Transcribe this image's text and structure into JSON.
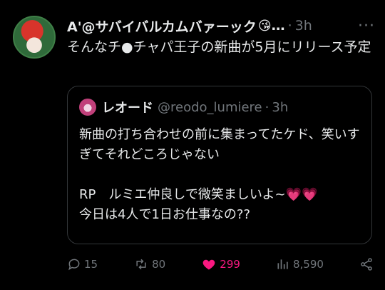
{
  "tweet": {
    "display_name": "A'@サバイバルカムバァーック",
    "emoji": "😘",
    "ellipsis": "…",
    "separator": "·",
    "time": "3h",
    "more": "···",
    "text": "そんなチ●チャパ王子の新曲が5月にリリース予定"
  },
  "quote": {
    "display_name": "レオード",
    "handle": "@reodo_lumiere",
    "separator": "·",
    "time": "3h",
    "text": "新曲の打ち合わせの前に集まってたケド、笑いすぎてそれどころじゃない\n\nRP　ルミエ仲良しで微笑ましいよ~💗💗\n今日は4人で1日お仕事なの??"
  },
  "actions": {
    "replies": "15",
    "retweets": "80",
    "likes": "299",
    "views": "8,590"
  },
  "colors": {
    "background": "#000000",
    "text": "#e7e9ea",
    "muted": "#71767b",
    "like": "#f91880",
    "border": "#333639"
  }
}
